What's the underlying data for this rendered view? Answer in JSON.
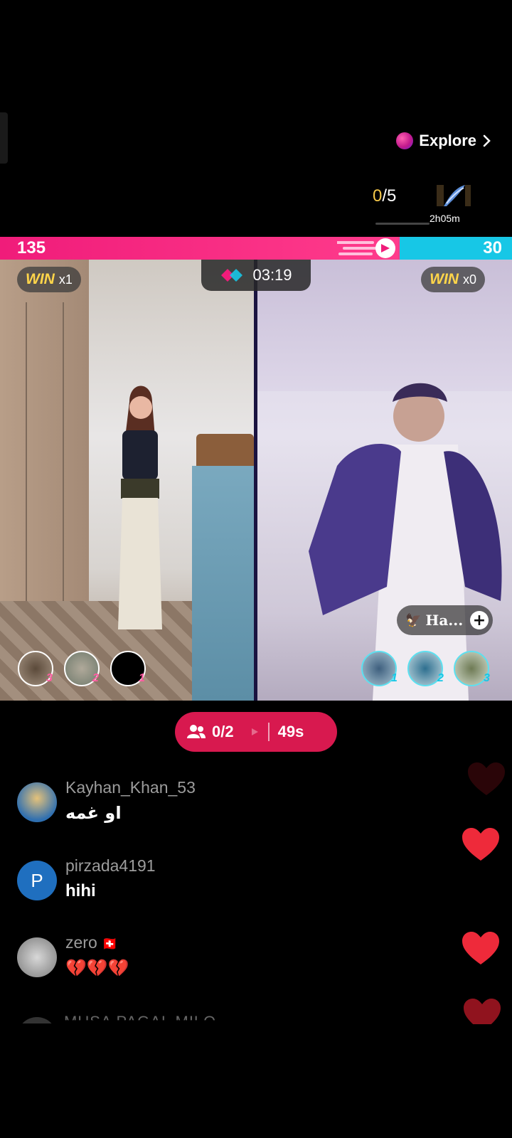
{
  "explore": {
    "label": "Explore"
  },
  "goal": {
    "current": "0",
    "total": "/5"
  },
  "gift": {
    "timer": "2h05m"
  },
  "battle": {
    "left_score": "135",
    "right_score": "30",
    "left_share": 0.78,
    "timer": "03:19",
    "left_wins": {
      "label": "WIN",
      "count": "x1"
    },
    "right_wins": {
      "label": "WIN",
      "count": "x0"
    }
  },
  "left_supporters": [
    {
      "rank": "3"
    },
    {
      "rank": "2"
    },
    {
      "rank": "1"
    }
  ],
  "right_supporters": [
    {
      "rank": "1"
    },
    {
      "rank": "2"
    },
    {
      "rank": "3"
    }
  ],
  "right_host": {
    "name": "Ha...",
    "follow_icon": "plus-icon"
  },
  "join": {
    "count": "0/2",
    "countdown": "49s"
  },
  "comments": [
    {
      "user": "Kayhan_Khan_53",
      "text": "او غمه"
    },
    {
      "user": "pirzada4191",
      "initial": "P",
      "text": "hihi"
    },
    {
      "user": "zero",
      "flag": "🇨🇭",
      "text": "💔💔💔"
    }
  ],
  "faded_comment": {
    "user": "MUSA PAGAL MILO"
  },
  "colors": {
    "left_team": "#f01c7a",
    "right_team": "#17c7e6",
    "win_label": "#ffd54a",
    "goal_current": "#f5c84a",
    "join_pill": "#d8194f",
    "heart": "#ee2a3a"
  }
}
